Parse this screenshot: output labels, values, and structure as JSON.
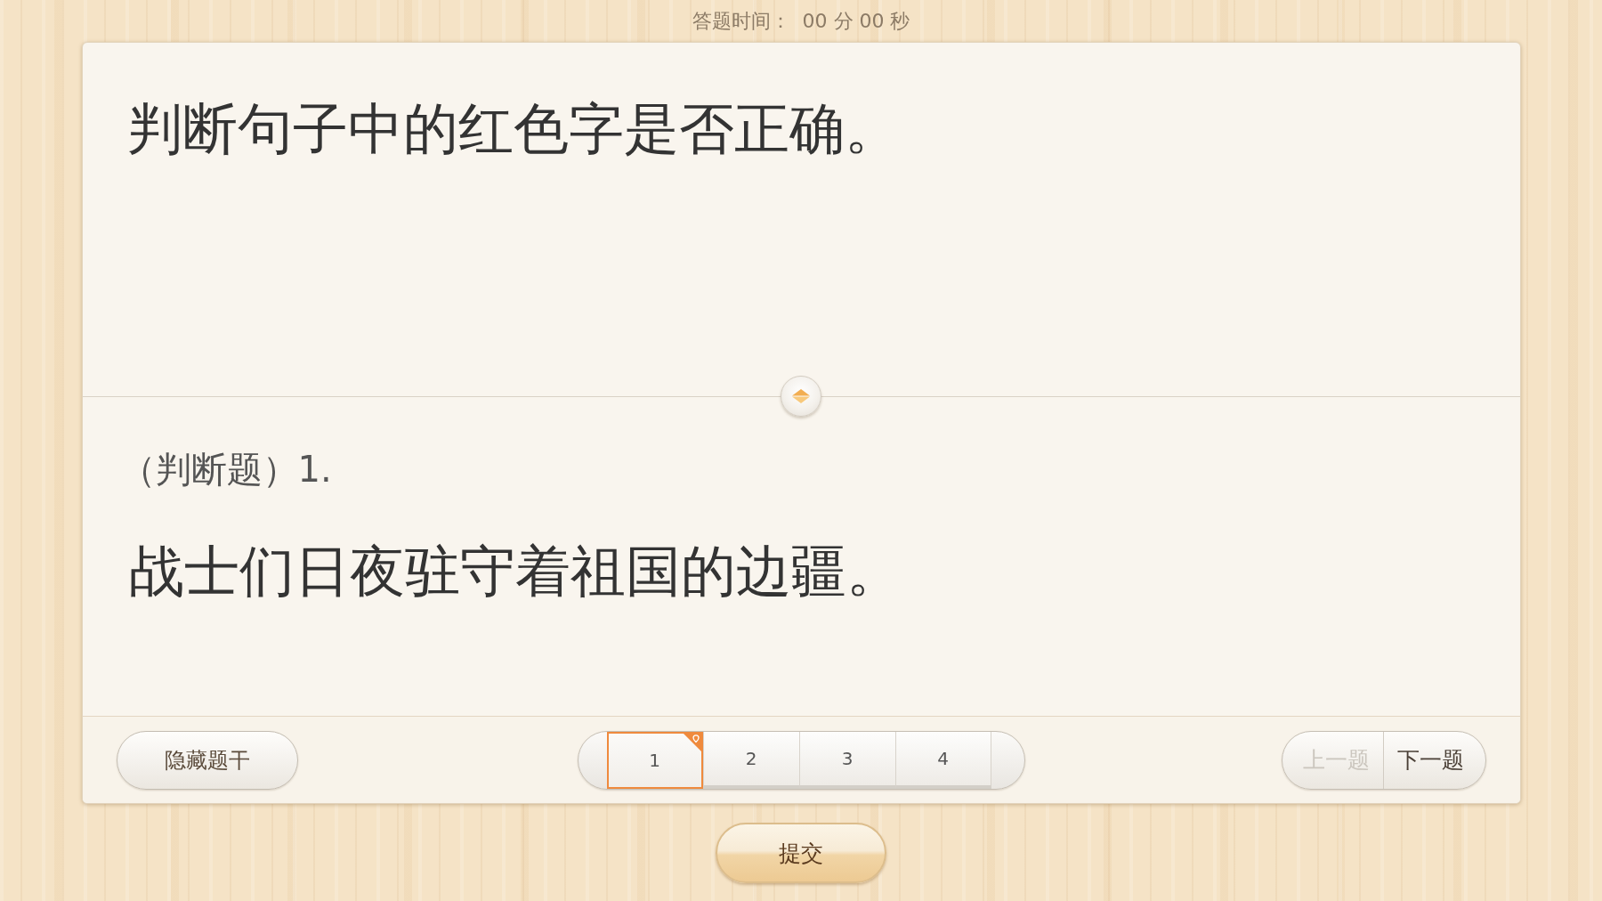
{
  "timer": {
    "label": "答题时间：",
    "value": "00 分 00 秒"
  },
  "stem": {
    "text": "判断句子中的红色字是否正确。"
  },
  "question": {
    "type_label": "（判断题）1.",
    "text": "战士们日夜驻守着祖国的边疆。"
  },
  "footer": {
    "toggle_button": "隐藏题干",
    "pages": [
      {
        "label": "1",
        "selected": true
      },
      {
        "label": "2",
        "selected": false
      },
      {
        "label": "3",
        "selected": false
      },
      {
        "label": "4",
        "selected": false
      }
    ],
    "prev_button": {
      "label": "上一题",
      "disabled": true
    },
    "next_button": {
      "label": "下一题",
      "disabled": false
    }
  },
  "submit_button": "提交"
}
